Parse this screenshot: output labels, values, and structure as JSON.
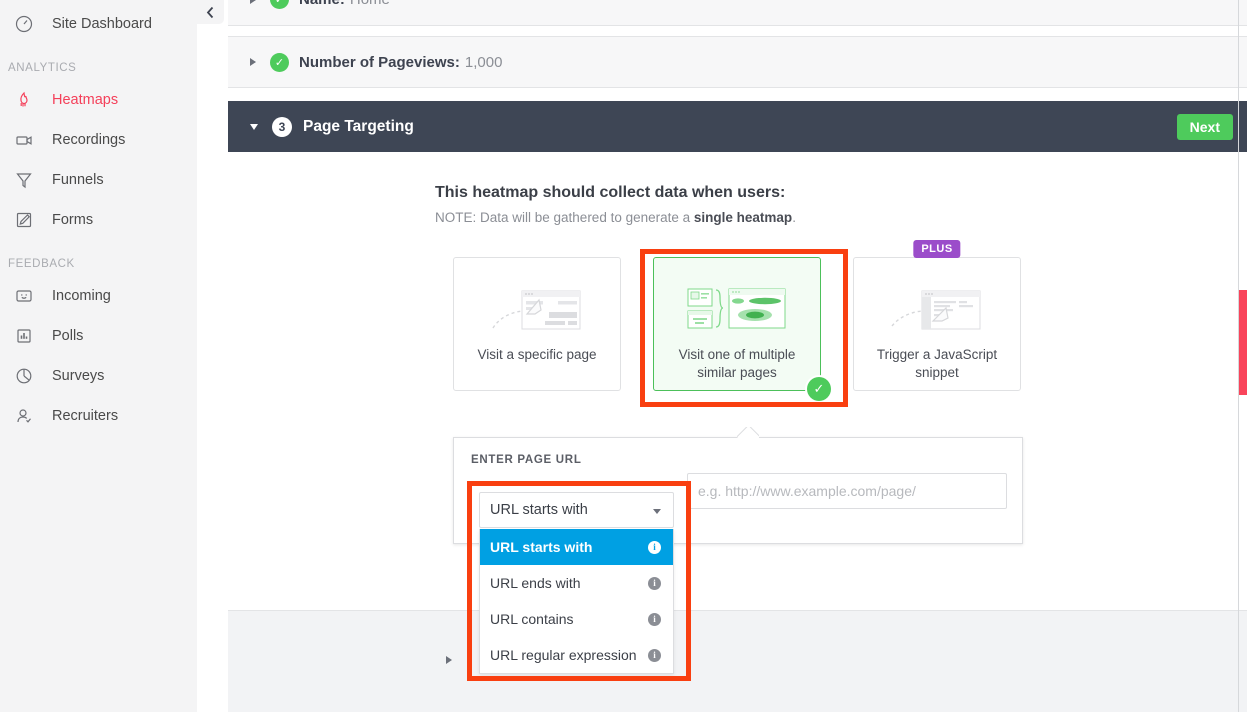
{
  "sidebar": {
    "items_top": [
      {
        "label": "Site Dashboard",
        "icon": "gauge-icon",
        "active": false
      }
    ],
    "sections": [
      {
        "title": "ANALYTICS",
        "items": [
          {
            "label": "Heatmaps",
            "icon": "flame-icon",
            "active": true
          },
          {
            "label": "Recordings",
            "icon": "video-camera-icon",
            "active": false
          },
          {
            "label": "Funnels",
            "icon": "funnel-icon",
            "active": false
          },
          {
            "label": "Forms",
            "icon": "pencil-form-icon",
            "active": false
          }
        ]
      },
      {
        "title": "FEEDBACK",
        "items": [
          {
            "label": "Incoming",
            "icon": "smiley-box-icon",
            "active": false
          },
          {
            "label": "Polls",
            "icon": "bar-chart-icon",
            "active": false
          },
          {
            "label": "Surveys",
            "icon": "pie-chart-icon",
            "active": false
          },
          {
            "label": "Recruiters",
            "icon": "person-check-icon",
            "active": false
          }
        ]
      }
    ],
    "collapse_icon": "chevron-left-icon"
  },
  "steps": {
    "name_row": {
      "label": "Name:",
      "value": "Home",
      "state": "complete"
    },
    "pageviews_row": {
      "label": "Number of Pageviews:",
      "value": "1,000",
      "state": "complete"
    }
  },
  "page_targeting": {
    "number": "3",
    "title": "Page Targeting",
    "next_label": "Next",
    "heading": "This heatmap should collect data when users:",
    "note_prefix": "NOTE: Data will be gathered to generate a ",
    "note_bold": "single heatmap",
    "note_suffix": ".",
    "options": [
      {
        "label": "Visit a specific page",
        "selected": false,
        "badge": ""
      },
      {
        "label": "Visit one of multiple similar pages",
        "selected": true,
        "badge": ""
      },
      {
        "label": "Trigger a JavaScript snippet",
        "selected": false,
        "badge": "PLUS"
      }
    ]
  },
  "url_panel": {
    "section_label": "ENTER PAGE URL",
    "selected_match": "URL starts with",
    "url_placeholder": "e.g. http://www.example.com/page/",
    "url_value": "",
    "match_options": [
      {
        "label": "URL starts with",
        "selected": true
      },
      {
        "label": "URL ends with",
        "selected": false
      },
      {
        "label": "URL contains",
        "selected": false
      },
      {
        "label": "URL regular expression",
        "selected": false
      }
    ],
    "info_glyph": "i"
  },
  "colors": {
    "accent_red": "#f4405a",
    "annotation_red": "#f93f10",
    "highlight_blue": "#00a0e3",
    "success_green": "#4ecb5c",
    "plus_purple": "#9b4dca",
    "header_dark": "#3e4655"
  }
}
